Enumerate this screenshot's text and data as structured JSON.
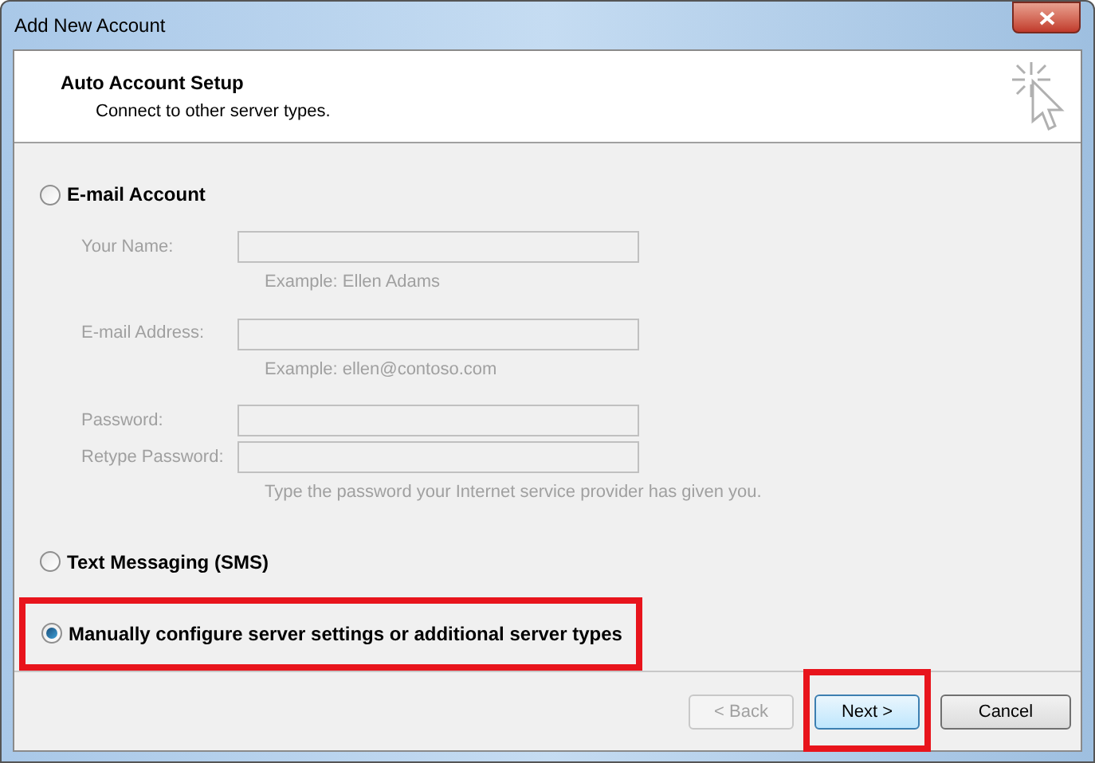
{
  "window": {
    "title": "Add New Account"
  },
  "header": {
    "title": "Auto Account Setup",
    "subtitle": "Connect to other server types."
  },
  "options": [
    {
      "kind": "email",
      "label": "E-mail Account",
      "selected": false,
      "highlighted": false,
      "disabled_fields": true,
      "fields": [
        {
          "label": "Your Name:",
          "hint": "Example: Ellen Adams"
        },
        {
          "label": "E-mail Address:",
          "hint": "Example: ellen@contoso.com"
        },
        {
          "label": "Password:"
        },
        {
          "label": "Retype Password:",
          "hint": "Type the password your Internet service provider has given you."
        }
      ]
    },
    {
      "kind": "plain",
      "label": "Text Messaging (SMS)",
      "selected": false,
      "highlighted": false
    },
    {
      "kind": "plain",
      "label": "Manually configure server settings or additional server types",
      "selected": true,
      "highlighted": true
    }
  ],
  "buttons": [
    {
      "label": "< Back",
      "disabled": true,
      "default": false,
      "highlighted": false
    },
    {
      "label": "Next >",
      "disabled": false,
      "default": true,
      "highlighted": true
    },
    {
      "label": "Cancel",
      "disabled": false,
      "default": false,
      "highlighted": false
    }
  ]
}
